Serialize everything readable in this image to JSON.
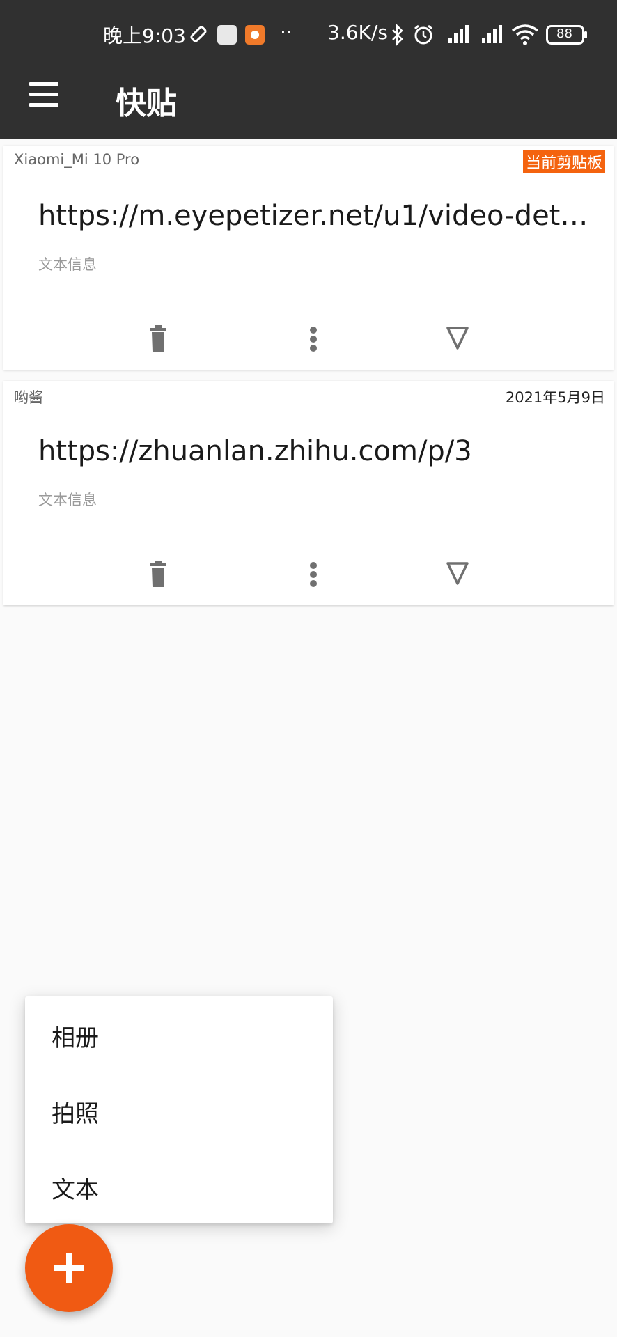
{
  "status_bar": {
    "time": "晚上9:03",
    "speed": "3.6K/s",
    "battery": "88",
    "more_indicator": "··"
  },
  "app_bar": {
    "title": "快贴",
    "menu_icon": "hamburger-menu-icon"
  },
  "clips": [
    {
      "device": "Xiaomi_Mi 10 Pro",
      "badge": "当前剪贴板",
      "url": "https://m.eyepetizer.net/u1/video-det…",
      "type": "文本信息"
    },
    {
      "device": "哟酱",
      "date": "2021年5月9日",
      "url": "https://zhuanlan.zhihu.com/p/3",
      "type": "文本信息"
    }
  ],
  "popup_menu": {
    "items": [
      "相册",
      "拍照",
      "文本"
    ]
  },
  "fab": {
    "icon": "plus-icon"
  },
  "colors": {
    "bar": "#303030",
    "accent": "#f05a13",
    "badge": "#f4630f",
    "background": "#fafafa"
  }
}
